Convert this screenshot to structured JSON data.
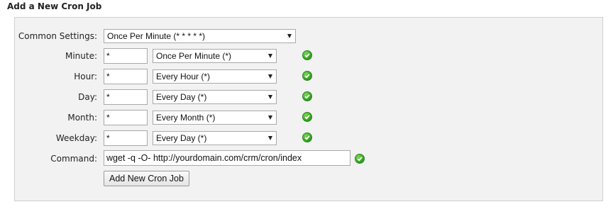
{
  "section_title": "Add a New Cron Job",
  "common_settings": {
    "label": "Common Settings:",
    "selected": "Once Per Minute (* * * * *)"
  },
  "fields": [
    {
      "label": "Minute:",
      "value": "*",
      "selected": "Once Per Minute (*)",
      "valid_icon": "checkmark-icon"
    },
    {
      "label": "Hour:",
      "value": "*",
      "selected": "Every Hour (*)",
      "valid_icon": "checkmark-icon"
    },
    {
      "label": "Day:",
      "value": "*",
      "selected": "Every Day (*)",
      "valid_icon": "checkmark-icon"
    },
    {
      "label": "Month:",
      "value": "*",
      "selected": "Every Month (*)",
      "valid_icon": "checkmark-icon"
    },
    {
      "label": "Weekday:",
      "value": "*",
      "selected": "Every Day (*)",
      "valid_icon": "checkmark-icon"
    }
  ],
  "command": {
    "label": "Command:",
    "value": "wget -q -O- http://yourdomain.com/crm/cron/index",
    "valid_icon": "checkmark-icon"
  },
  "submit_label": "Add New Cron Job",
  "colors": {
    "panel_bg": "#f2f2f2",
    "check_green": "#3aa82a"
  }
}
